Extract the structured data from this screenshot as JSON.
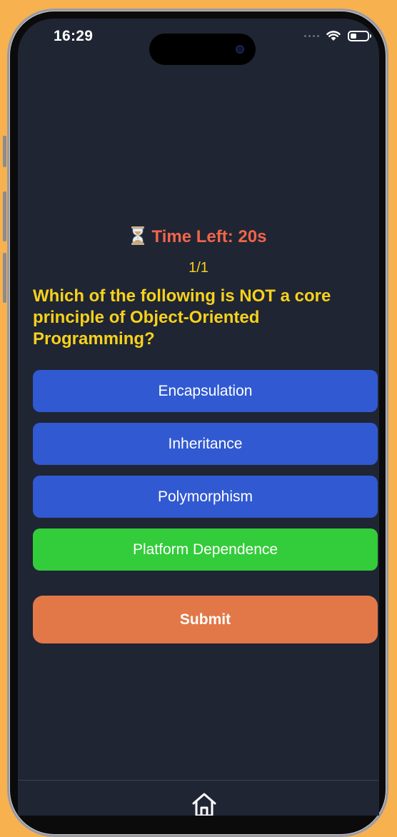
{
  "status_bar": {
    "time": "16:29"
  },
  "quiz": {
    "timer_text": "Time Left: 20s",
    "timer_icon": "hourglass-icon",
    "progress": "1/1",
    "question": "Which of the following is NOT a core principle of Object-Oriented Programming?",
    "options": [
      {
        "label": "Encapsulation",
        "state": "default"
      },
      {
        "label": "Inheritance",
        "state": "default"
      },
      {
        "label": "Polymorphism",
        "state": "default"
      },
      {
        "label": "Platform Dependence",
        "state": "selected"
      }
    ],
    "submit_label": "Submit"
  },
  "colors": {
    "background": "#1f2533",
    "timer": "#f2644a",
    "question": "#f7d11c",
    "option_default": "#3159d1",
    "option_selected": "#33cc3a",
    "submit": "#e27848",
    "page_backdrop": "#f7b14f"
  },
  "tab_bar": {
    "items": [
      {
        "icon": "home-icon"
      }
    ]
  }
}
